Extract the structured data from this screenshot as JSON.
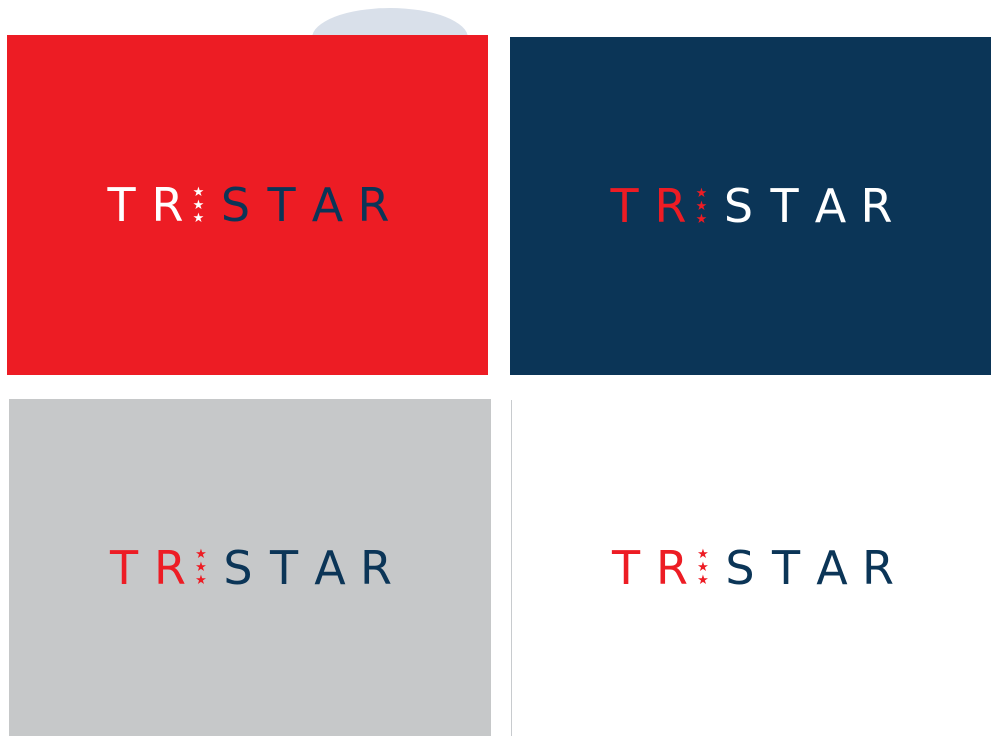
{
  "logo": {
    "wordmark": "TRISTAR",
    "letters_before": [
      "T",
      "R"
    ],
    "letters_after": [
      "S",
      "T",
      "A",
      "R"
    ],
    "star_glyph": "★"
  },
  "variants": [
    {
      "name": "red-background",
      "background": "#ed1c24",
      "primary_color": "#ffffff",
      "secondary_color": "#0b3557",
      "star_color": "#ffffff"
    },
    {
      "name": "navy-background",
      "background": "#0b3557",
      "primary_color": "#ed1c24",
      "secondary_color": "#ffffff",
      "star_color": "#ed1c24"
    },
    {
      "name": "gray-background",
      "background": "#c6c8c9",
      "primary_color": "#ed1c24",
      "secondary_color": "#0b3557",
      "star_color": "#ed1c24"
    },
    {
      "name": "white-background",
      "background": "#ffffff",
      "primary_color": "#ed1c24",
      "secondary_color": "#0b3557",
      "star_color": "#ed1c24"
    }
  ]
}
